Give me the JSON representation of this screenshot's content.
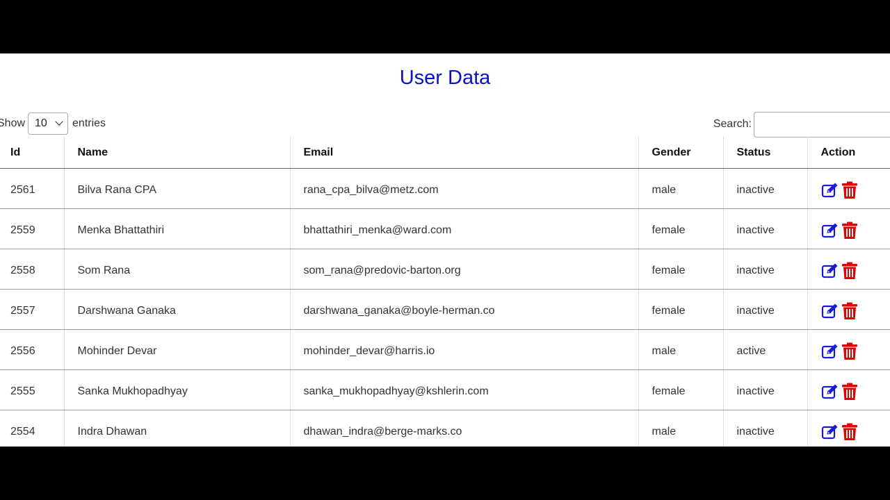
{
  "page": {
    "title": "User Data"
  },
  "length_menu": {
    "prefix": "Show",
    "selected": "10",
    "suffix": "entries"
  },
  "search": {
    "label": "Search:",
    "value": ""
  },
  "table": {
    "columns": [
      "Id",
      "Name",
      "Email",
      "Gender",
      "Status",
      "Action"
    ],
    "rows": [
      {
        "id": "2561",
        "name": "Bilva Rana CPA",
        "email": "rana_cpa_bilva@metz.com",
        "gender": "male",
        "status": "inactive"
      },
      {
        "id": "2559",
        "name": "Menka Bhattathiri",
        "email": "bhattathiri_menka@ward.com",
        "gender": "female",
        "status": "inactive"
      },
      {
        "id": "2558",
        "name": "Som Rana",
        "email": "som_rana@predovic-barton.org",
        "gender": "female",
        "status": "inactive"
      },
      {
        "id": "2557",
        "name": "Darshwana Ganaka",
        "email": "darshwana_ganaka@boyle-herman.co",
        "gender": "female",
        "status": "inactive"
      },
      {
        "id": "2556",
        "name": "Mohinder Devar",
        "email": "mohinder_devar@harris.io",
        "gender": "male",
        "status": "active"
      },
      {
        "id": "2555",
        "name": "Sanka Mukhopadhyay",
        "email": "sanka_mukhopadhyay@kshlerin.com",
        "gender": "female",
        "status": "inactive"
      },
      {
        "id": "2554",
        "name": "Indra Dhawan",
        "email": "dhawan_indra@berge-marks.co",
        "gender": "male",
        "status": "inactive"
      }
    ]
  },
  "icons": {
    "edit": "edit-icon",
    "delete": "trash-icon"
  },
  "colors": {
    "title": "#0a12c9",
    "edit": "#1a1ad6",
    "delete": "#e00000"
  }
}
